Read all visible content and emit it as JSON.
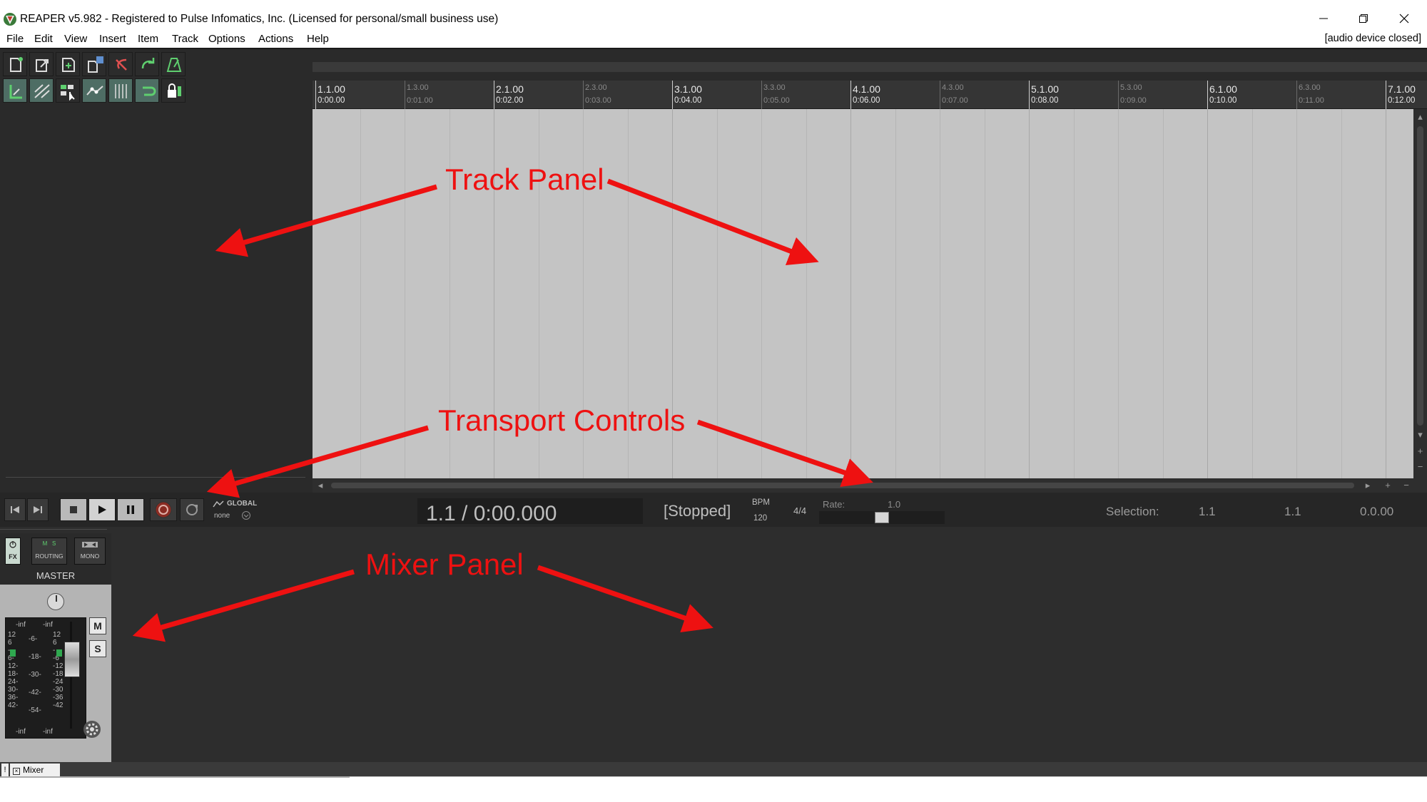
{
  "window": {
    "title": "REAPER v5.982 - Registered to Pulse Infomatics, Inc. (Licensed for personal/small business use)",
    "audio_status": "[audio device closed]"
  },
  "menu": [
    "File",
    "Edit",
    "View",
    "Insert",
    "Item",
    "Track",
    "Options",
    "Actions",
    "Help"
  ],
  "ruler": {
    "major": [
      {
        "label": "1.1.00",
        "time": "0:00.00"
      },
      {
        "label": "2.1.00",
        "time": "0:02.00"
      },
      {
        "label": "3.1.00",
        "time": "0:04.00"
      },
      {
        "label": "4.1.00",
        "time": "0:06.00"
      },
      {
        "label": "5.1.00",
        "time": "0:08.00"
      },
      {
        "label": "6.1.00",
        "time": "0:10.00"
      },
      {
        "label": "7.1.00",
        "time": "0:12.00"
      }
    ],
    "minor": [
      {
        "label": "1.3.00",
        "time": "0:01.00"
      },
      {
        "label": "2.3.00",
        "time": "0:03.00"
      },
      {
        "label": "3.3.00",
        "time": "0:05.00"
      },
      {
        "label": "4.3.00",
        "time": "0:07.00"
      },
      {
        "label": "5.3.00",
        "time": "0:09.00"
      },
      {
        "label": "6.3.00",
        "time": "0:11.00"
      }
    ]
  },
  "transport": {
    "global_label": "GLOBAL",
    "global_value": "none",
    "time": "1.1 / 0:00.000",
    "state": "[Stopped]",
    "bpm_label": "BPM",
    "bpm_value": "120",
    "time_signature": "4/4",
    "rate_label": "Rate:",
    "rate_value": "1.0",
    "selection_label": "Selection:",
    "selection_start": "1.1",
    "selection_end": "1.1",
    "selection_length": "0.0.00"
  },
  "mixer": {
    "fx_label": "FX",
    "routing_label": "ROUTING",
    "mono_label": "MONO",
    "master_label": "MASTER",
    "mute_label": "M",
    "solo_label": "S",
    "meter_top_left": "-inf",
    "meter_top_right": "-inf",
    "meter_bottom_left": "-inf",
    "meter_bottom_right": "-inf",
    "meter_scale_left": [
      "12",
      "6",
      "-",
      "6-",
      "12-",
      "18-",
      "24-",
      "30-",
      "36-",
      "42-"
    ],
    "meter_scale_right": [
      "12",
      "6",
      "-",
      "-6",
      "-12",
      "-18",
      "-24",
      "-30",
      "-36",
      "-42"
    ],
    "meter_center": [
      "-6-",
      "-18-",
      "-30-",
      "-42-",
      "-54-"
    ]
  },
  "dock": {
    "tab_label": "Mixer",
    "excl": "!"
  },
  "annotations": {
    "track_panel": "Track Panel",
    "transport_controls": "Transport Controls",
    "mixer_panel": "Mixer Panel"
  },
  "colors": {
    "annotation": "#ee1111",
    "arrange_bg": "#c4c4c4",
    "dark_bg": "#2a2a2a",
    "toolbar_active": "#4e6d64",
    "record": "#c0392b"
  }
}
